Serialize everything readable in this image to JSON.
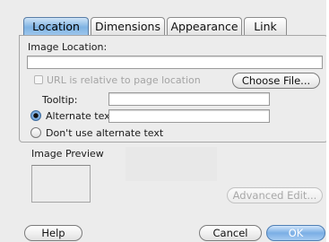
{
  "tabs": [
    {
      "label": "Location",
      "active": true
    },
    {
      "label": "Dimensions",
      "active": false
    },
    {
      "label": "Appearance",
      "active": false
    },
    {
      "label": "Link",
      "active": false
    }
  ],
  "location": {
    "image_location_label": "Image Location:",
    "image_location_value": "",
    "url_relative_label": "URL is relative to page location",
    "url_relative_checked": false,
    "choose_file_label": "Choose File...",
    "tooltip_label": "Tooltip:",
    "tooltip_value": "",
    "alternate_text_label": "Alternate text:",
    "alternate_text_value": "",
    "alternate_text_selected": true,
    "no_alt_text_label": "Don't use alternate text",
    "no_alt_text_selected": false
  },
  "preview": {
    "label": "Image Preview",
    "advanced_edit_label": "Advanced Edit..."
  },
  "footer": {
    "help_label": "Help",
    "cancel_label": "Cancel",
    "ok_label": "OK"
  },
  "colors": {
    "active_tab": "#7fb3e3",
    "dialog_background": "#ececec",
    "primary_button": "#7aaee5"
  }
}
